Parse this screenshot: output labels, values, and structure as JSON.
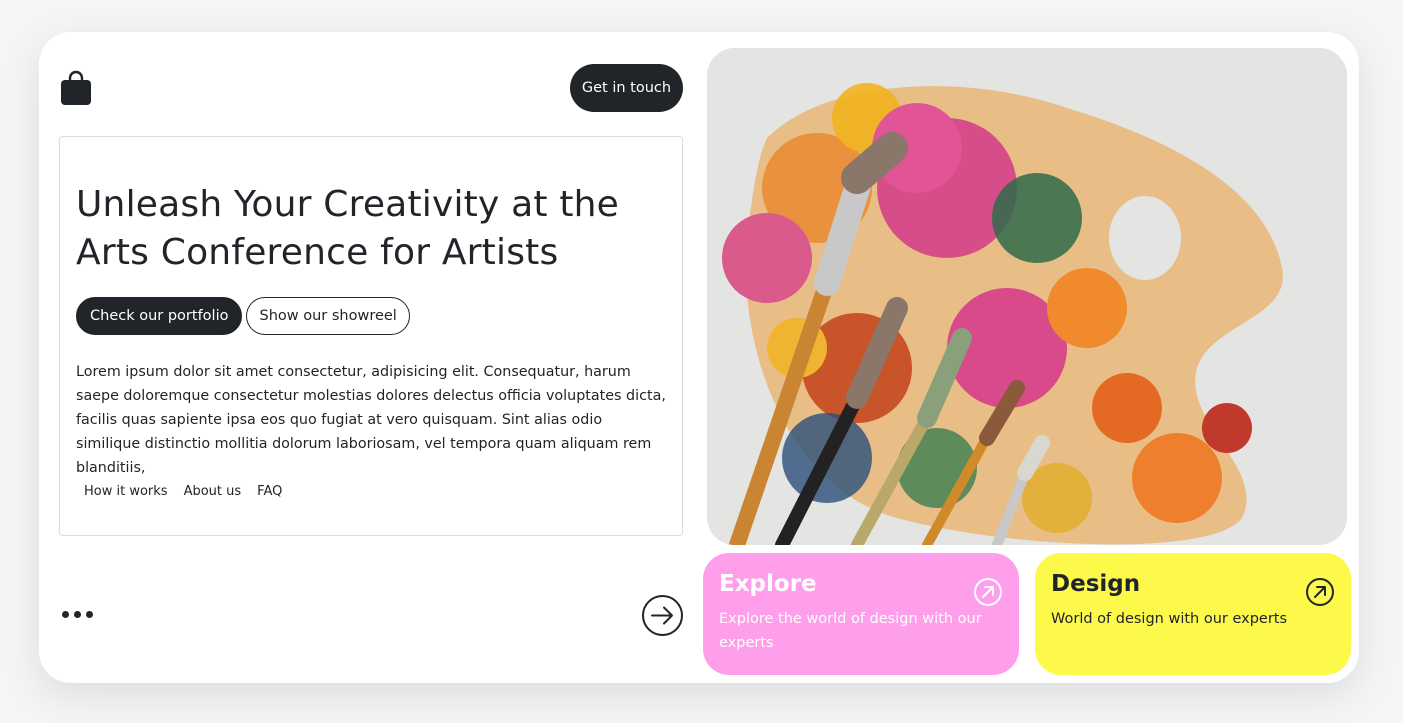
{
  "header": {
    "logo_icon": "shopping-bag-icon",
    "cta_label": "Get in touch"
  },
  "hero": {
    "title": "Unleash Your Creativity at the Arts Conference for Artists",
    "primary_button": "Check our portfolio",
    "secondary_button": "Show our showreel",
    "body": "Lorem ipsum dolor sit amet consectetur, adipisicing elit. Consequatur, harum saepe doloremque consectetur molestias dolores delectus officia voluptates dicta, facilis quas sapiente ipsa eos quo fugiat at vero quisquam. Sint alias odio similique distinctio mollitia dolorum laboriosam, vel tempora quam aliquam rem blanditiis,",
    "links": [
      "How it works",
      "About us",
      "FAQ"
    ]
  },
  "footer": {
    "more_icon": "more-dots-icon",
    "next_icon": "arrow-right-circle-icon"
  },
  "image": {
    "subject": "paint-palette-with-brushes"
  },
  "tiles": [
    {
      "title": "Explore",
      "text": "Explore the world of design with our experts",
      "icon": "arrow-up-right-circle-icon",
      "color": "#ff9eea"
    },
    {
      "title": "Design",
      "text": "World of design with our experts",
      "icon": "arrow-up-right-circle-icon",
      "color": "#fdf94b"
    }
  ],
  "colors": {
    "dark": "#212529",
    "background": "#f4f5f7",
    "pink": "#ff9eea",
    "yellow": "#fdf94b"
  }
}
